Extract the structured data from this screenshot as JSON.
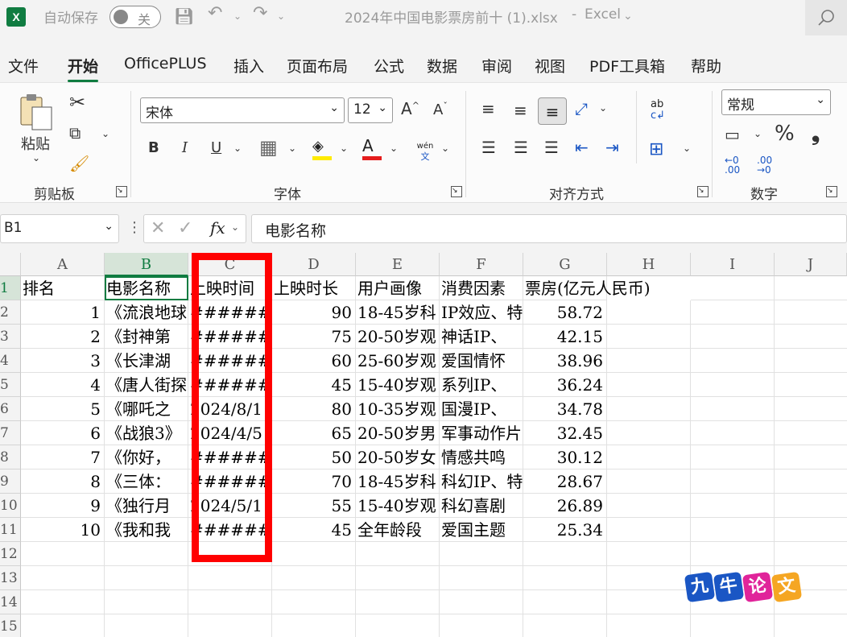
{
  "titlebar": {
    "app_icon": "X",
    "autosave_label": "自动保存",
    "autosave_state": "关",
    "document_title": "2024年中国电影票房前十 (1).xlsx",
    "app_name": "Excel"
  },
  "menu": [
    "文件",
    "开始",
    "OfficePLUS",
    "插入",
    "页面布局",
    "公式",
    "数据",
    "审阅",
    "视图",
    "PDF工具箱",
    "帮助"
  ],
  "ribbon": {
    "clipboard": {
      "paste_label": "粘贴",
      "group_label": "剪贴板"
    },
    "font": {
      "font_name": "宋体",
      "font_size": "12",
      "bold": "B",
      "italic": "I",
      "underline": "U",
      "group_label": "字体",
      "phonetic_top": "wén",
      "phonetic_bottom": "文"
    },
    "alignment": {
      "group_label": "对齐方式"
    },
    "number": {
      "format": "常规",
      "group_label": "数字",
      "percent": "%",
      "comma": "❟",
      "inc_decimal": "←0 .00",
      "dec_decimal": ".00 →0"
    }
  },
  "formula_bar": {
    "name_box": "B1",
    "formula": "电影名称",
    "fx": "fx"
  },
  "columns": [
    "A",
    "B",
    "C",
    "D",
    "E",
    "F",
    "G",
    "H",
    "I",
    "J"
  ],
  "rows": [
    "1",
    "2",
    "3",
    "4",
    "5",
    "6",
    "7",
    "8",
    "9",
    "10",
    "11",
    "12",
    "13",
    "14",
    "15"
  ],
  "sheet": {
    "header": [
      "排名",
      "电影名称",
      "上映时间",
      "上映时长",
      "用户画像",
      "消费因素",
      "票房(亿元人民币)"
    ],
    "data": [
      [
        "1",
        "《流浪地球",
        "########",
        "90",
        "18-45岁科",
        "IP效应、特",
        "58.72"
      ],
      [
        "2",
        "《封神第",
        "########",
        "75",
        "20-50岁观",
        "神话IP、",
        "42.15"
      ],
      [
        "3",
        "《长津湖",
        "########",
        "60",
        "25-60岁观",
        "爱国情怀",
        "38.96"
      ],
      [
        "4",
        "《唐人街探",
        "########",
        "45",
        "15-40岁观",
        "系列IP、",
        "36.24"
      ],
      [
        "5",
        "《哪吒之",
        "2024/8/1",
        "80",
        "10-35岁观",
        "国漫IP、",
        "34.78"
      ],
      [
        "6",
        "《战狼3》",
        "2024/4/5",
        "65",
        "20-50岁男",
        "军事动作片",
        "32.45"
      ],
      [
        "7",
        "《你好，",
        "########",
        "50",
        "20-50岁女",
        "情感共鸣",
        "30.12"
      ],
      [
        "8",
        "《三体：",
        "########",
        "70",
        "18-45岁科",
        "科幻IP、特",
        "28.67"
      ],
      [
        "9",
        "《独行月",
        "2024/5/1",
        "55",
        "15-40岁观",
        "科幻喜剧",
        "26.89"
      ],
      [
        "10",
        "《我和我",
        "########",
        "45",
        "全年龄段",
        "爱国主题",
        "25.34"
      ]
    ]
  },
  "watermark": {
    "chars": [
      "九",
      "牛",
      "论",
      "文"
    ],
    "colors": [
      "#1a56c4",
      "#1a56c4",
      "#e0249a",
      "#f5a623"
    ]
  }
}
